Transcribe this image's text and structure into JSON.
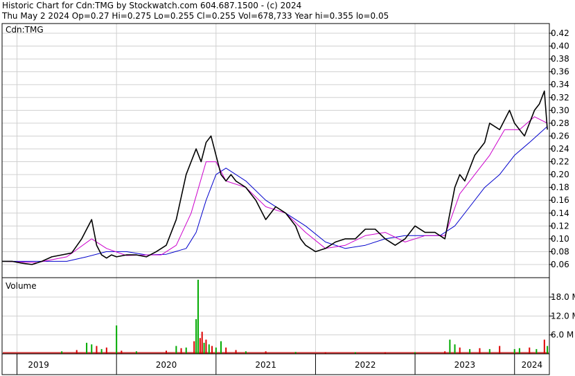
{
  "header": {
    "line1": "Historic Chart for Cdn:TMG by Stockwatch.com 604.687.1500 - (c) 2024",
    "line2": "Thu May  2 2024   Op=0.27  Hi=0.275  Lo=0.255  Cl=0.255  Vol=678,733  Year hi=0.355  lo=0.05"
  },
  "chart_data": [
    {
      "type": "line",
      "title": "Cdn:TMG",
      "y_ticks": [
        "0.42",
        "0.40",
        "0.38",
        "0.36",
        "0.34",
        "0.32",
        "0.30",
        "0.28",
        "0.26",
        "0.24",
        "0.22",
        "0.20",
        "0.18",
        "0.16",
        "0.14",
        "0.12",
        "0.10",
        "0.08",
        "0.06"
      ],
      "ylim": [
        0.045,
        0.43
      ],
      "xlim": [
        2018.85,
        2024.35
      ],
      "grid": true,
      "colors": {
        "price": "#000000",
        "ma_short": "#cc00cc",
        "ma_long": "#0000cc"
      },
      "series": [
        {
          "key": "price",
          "x": [
            2018.85,
            2018.95,
            2019.05,
            2019.15,
            2019.25,
            2019.35,
            2019.45,
            2019.55,
            2019.65,
            2019.75,
            2019.8,
            2019.85,
            2019.9,
            2019.95,
            2020.0,
            2020.1,
            2020.2,
            2020.3,
            2020.4,
            2020.5,
            2020.6,
            2020.7,
            2020.8,
            2020.85,
            2020.9,
            2020.95,
            2021.0,
            2021.05,
            2021.1,
            2021.15,
            2021.2,
            2021.25,
            2021.3,
            2021.4,
            2021.5,
            2021.6,
            2021.7,
            2021.8,
            2021.85,
            2021.9,
            2022.0,
            2022.1,
            2022.2,
            2022.3,
            2022.4,
            2022.5,
            2022.6,
            2022.7,
            2022.8,
            2022.9,
            2023.0,
            2023.1,
            2023.2,
            2023.3,
            2023.35,
            2023.4,
            2023.45,
            2023.5,
            2023.55,
            2023.6,
            2023.7,
            2023.75,
            2023.85,
            2023.95,
            2024.0,
            2024.05,
            2024.1,
            2024.15,
            2024.2,
            2024.25,
            2024.3,
            2024.33
          ],
          "y": [
            0.065,
            0.065,
            0.062,
            0.06,
            0.065,
            0.072,
            0.075,
            0.078,
            0.1,
            0.13,
            0.09,
            0.075,
            0.07,
            0.075,
            0.072,
            0.075,
            0.075,
            0.072,
            0.08,
            0.09,
            0.13,
            0.2,
            0.24,
            0.22,
            0.25,
            0.26,
            0.23,
            0.2,
            0.19,
            0.2,
            0.19,
            0.185,
            0.18,
            0.16,
            0.13,
            0.15,
            0.14,
            0.12,
            0.1,
            0.09,
            0.08,
            0.085,
            0.095,
            0.1,
            0.1,
            0.115,
            0.115,
            0.1,
            0.09,
            0.1,
            0.12,
            0.11,
            0.11,
            0.1,
            0.14,
            0.18,
            0.2,
            0.19,
            0.21,
            0.23,
            0.25,
            0.28,
            0.27,
            0.3,
            0.28,
            0.27,
            0.26,
            0.28,
            0.3,
            0.31,
            0.33,
            0.27
          ]
        },
        {
          "key": "ma_short",
          "x": [
            2018.85,
            2019.2,
            2019.5,
            2019.75,
            2019.9,
            2020.1,
            2020.3,
            2020.45,
            2020.6,
            2020.75,
            2020.9,
            2021.0,
            2021.1,
            2021.3,
            2021.5,
            2021.7,
            2021.9,
            2022.1,
            2022.3,
            2022.5,
            2022.7,
            2022.9,
            2023.1,
            2023.3,
            2023.45,
            2023.6,
            2023.75,
            2023.9,
            2024.05,
            2024.2,
            2024.33
          ],
          "y": [
            0.065,
            0.063,
            0.072,
            0.1,
            0.085,
            0.074,
            0.075,
            0.075,
            0.09,
            0.14,
            0.22,
            0.22,
            0.19,
            0.18,
            0.15,
            0.14,
            0.11,
            0.085,
            0.09,
            0.105,
            0.11,
            0.095,
            0.105,
            0.105,
            0.17,
            0.2,
            0.23,
            0.27,
            0.27,
            0.29,
            0.28
          ]
        },
        {
          "key": "ma_long",
          "x": [
            2018.85,
            2019.2,
            2019.5,
            2019.7,
            2019.9,
            2020.1,
            2020.3,
            2020.5,
            2020.7,
            2020.8,
            2020.9,
            2021.0,
            2021.1,
            2021.3,
            2021.5,
            2021.7,
            2021.9,
            2022.1,
            2022.3,
            2022.5,
            2022.7,
            2022.9,
            2023.1,
            2023.25,
            2023.4,
            2023.55,
            2023.7,
            2023.85,
            2024.0,
            2024.15,
            2024.33
          ],
          "y": [
            0.065,
            0.065,
            0.065,
            0.072,
            0.08,
            0.08,
            0.075,
            0.076,
            0.085,
            0.11,
            0.16,
            0.2,
            0.21,
            0.19,
            0.16,
            0.14,
            0.12,
            0.095,
            0.085,
            0.09,
            0.1,
            0.105,
            0.105,
            0.105,
            0.12,
            0.15,
            0.18,
            0.2,
            0.23,
            0.25,
            0.275
          ]
        }
      ]
    },
    {
      "type": "bar",
      "title": "Volume",
      "y_ticks": [
        "18.0 M",
        "12.0 M",
        "6.0 M"
      ],
      "ylim": [
        0,
        24
      ],
      "x_ticks": [
        "2019",
        "2020",
        "2021",
        "2022",
        "2023",
        "2024"
      ],
      "grid": true,
      "colors": {
        "up": "#00aa00",
        "down": "#dd0000"
      },
      "bars": [
        {
          "x": 2019.45,
          "value": 0.8,
          "dir": "up"
        },
        {
          "x": 2019.6,
          "value": 1.2,
          "dir": "down"
        },
        {
          "x": 2019.7,
          "value": 3.5,
          "dir": "up"
        },
        {
          "x": 2019.75,
          "value": 3.0,
          "dir": "up"
        },
        {
          "x": 2019.8,
          "value": 2.5,
          "dir": "down"
        },
        {
          "x": 2019.85,
          "value": 1.5,
          "dir": "up"
        },
        {
          "x": 2019.9,
          "value": 2.0,
          "dir": "down"
        },
        {
          "x": 2020.0,
          "value": 9.0,
          "dir": "up"
        },
        {
          "x": 2020.05,
          "value": 1.0,
          "dir": "down"
        },
        {
          "x": 2020.2,
          "value": 0.8,
          "dir": "up"
        },
        {
          "x": 2020.5,
          "value": 1.0,
          "dir": "down"
        },
        {
          "x": 2020.6,
          "value": 2.5,
          "dir": "up"
        },
        {
          "x": 2020.65,
          "value": 1.8,
          "dir": "down"
        },
        {
          "x": 2020.7,
          "value": 2.0,
          "dir": "up"
        },
        {
          "x": 2020.78,
          "value": 4.0,
          "dir": "down"
        },
        {
          "x": 2020.8,
          "value": 11.0,
          "dir": "up"
        },
        {
          "x": 2020.82,
          "value": 23.5,
          "dir": "up"
        },
        {
          "x": 2020.84,
          "value": 5.0,
          "dir": "down"
        },
        {
          "x": 2020.86,
          "value": 7.0,
          "dir": "down"
        },
        {
          "x": 2020.88,
          "value": 3.5,
          "dir": "up"
        },
        {
          "x": 2020.9,
          "value": 4.5,
          "dir": "down"
        },
        {
          "x": 2020.93,
          "value": 3.0,
          "dir": "up"
        },
        {
          "x": 2020.96,
          "value": 2.5,
          "dir": "down"
        },
        {
          "x": 2021.0,
          "value": 2.0,
          "dir": "up"
        },
        {
          "x": 2021.05,
          "value": 4.0,
          "dir": "up"
        },
        {
          "x": 2021.1,
          "value": 2.0,
          "dir": "down"
        },
        {
          "x": 2021.2,
          "value": 1.2,
          "dir": "down"
        },
        {
          "x": 2021.3,
          "value": 0.8,
          "dir": "up"
        },
        {
          "x": 2021.5,
          "value": 0.8,
          "dir": "down"
        },
        {
          "x": 2021.8,
          "value": 0.6,
          "dir": "up"
        },
        {
          "x": 2022.1,
          "value": 0.5,
          "dir": "down"
        },
        {
          "x": 2022.4,
          "value": 0.5,
          "dir": "up"
        },
        {
          "x": 2022.7,
          "value": 0.5,
          "dir": "down"
        },
        {
          "x": 2023.0,
          "value": 0.5,
          "dir": "up"
        },
        {
          "x": 2023.3,
          "value": 0.8,
          "dir": "down"
        },
        {
          "x": 2023.35,
          "value": 4.5,
          "dir": "up"
        },
        {
          "x": 2023.4,
          "value": 3.0,
          "dir": "up"
        },
        {
          "x": 2023.45,
          "value": 2.0,
          "dir": "down"
        },
        {
          "x": 2023.55,
          "value": 1.5,
          "dir": "up"
        },
        {
          "x": 2023.65,
          "value": 1.8,
          "dir": "down"
        },
        {
          "x": 2023.75,
          "value": 1.5,
          "dir": "up"
        },
        {
          "x": 2023.85,
          "value": 2.5,
          "dir": "down"
        },
        {
          "x": 2024.0,
          "value": 1.5,
          "dir": "up"
        },
        {
          "x": 2024.05,
          "value": 1.8,
          "dir": "up"
        },
        {
          "x": 2024.15,
          "value": 2.0,
          "dir": "down"
        },
        {
          "x": 2024.22,
          "value": 1.5,
          "dir": "up"
        },
        {
          "x": 2024.3,
          "value": 4.5,
          "dir": "down"
        },
        {
          "x": 2024.33,
          "value": 2.5,
          "dir": "up"
        }
      ]
    }
  ]
}
